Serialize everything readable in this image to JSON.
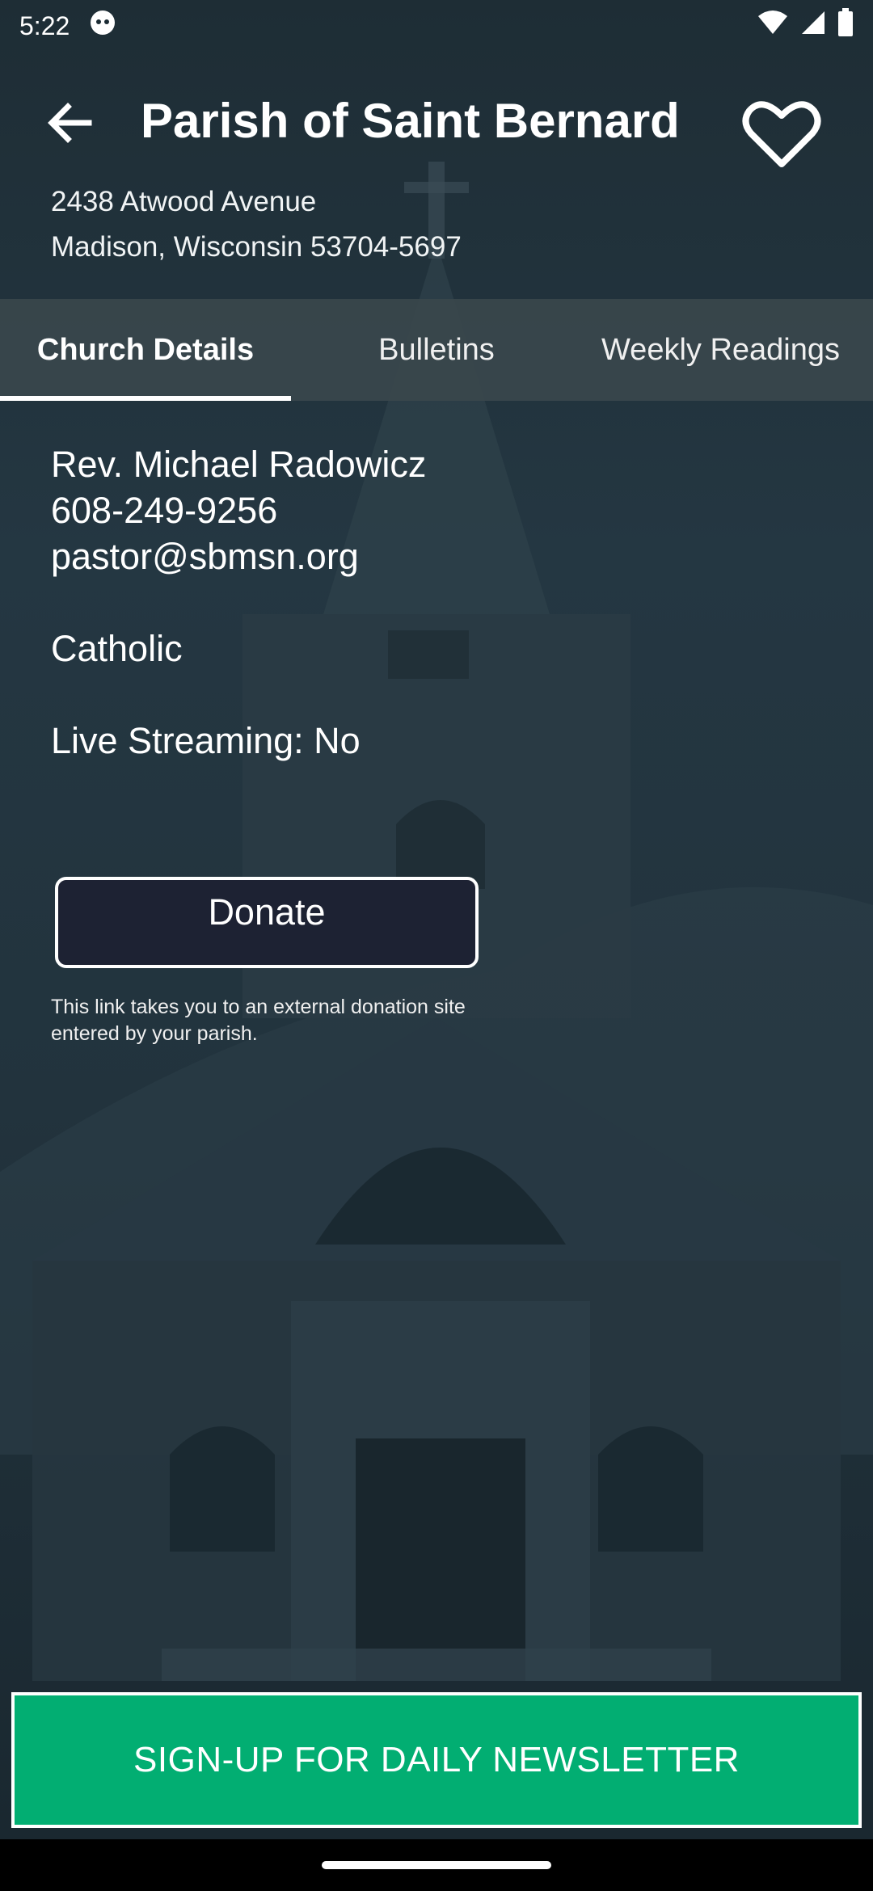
{
  "status_bar": {
    "time": "5:22"
  },
  "header": {
    "title": "Parish of Saint Bernard",
    "address_line1": "2438 Atwood Avenue",
    "address_line2": "Madison, Wisconsin 53704-5697"
  },
  "tabs": [
    {
      "label": "Church Details",
      "active": true
    },
    {
      "label": "Bulletins",
      "active": false
    },
    {
      "label": "Weekly Readings",
      "active": false
    }
  ],
  "details": {
    "pastor": "Rev. Michael Radowicz",
    "phone": "608-249-9256",
    "email": "pastor@sbmsn.org",
    "denomination": "Catholic",
    "live_streaming": "Live Streaming:  No"
  },
  "donate": {
    "label": "Donate",
    "note": "This link takes you to an external donation site entered by your parish."
  },
  "newsletter": {
    "label": "SIGN-UP FOR DAILY NEWSLETTER"
  },
  "colors": {
    "accent_green": "#02ae72",
    "background": "#1b2b33",
    "tab_bar": "#3a464c"
  }
}
